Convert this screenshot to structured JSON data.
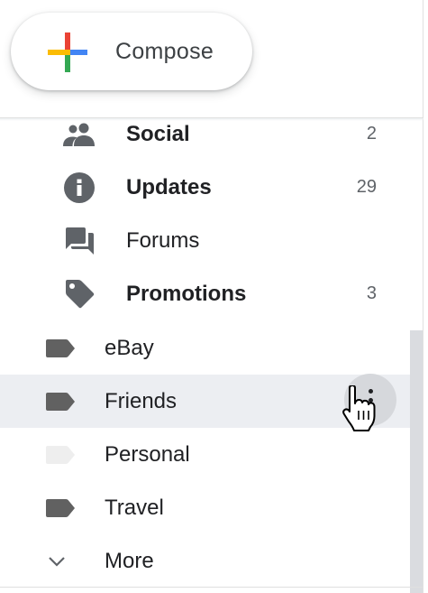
{
  "compose": {
    "label": "Compose"
  },
  "categories": [
    {
      "name": "Social",
      "count": "2",
      "icon": "people-icon",
      "bold": true
    },
    {
      "name": "Updates",
      "count": "29",
      "icon": "info-icon",
      "bold": true
    },
    {
      "name": "Forums",
      "count": "",
      "icon": "forum-icon",
      "bold": false
    },
    {
      "name": "Promotions",
      "count": "3",
      "icon": "tag-icon",
      "bold": true
    }
  ],
  "labels": [
    {
      "name": "eBay",
      "icon": "label-icon",
      "color": "#616161"
    },
    {
      "name": "Friends",
      "icon": "label-icon",
      "color": "#616161",
      "hovered": true
    },
    {
      "name": "Personal",
      "icon": "label-icon",
      "color": "#eeeeee"
    },
    {
      "name": "Travel",
      "icon": "label-icon",
      "color": "#616161"
    }
  ],
  "more": {
    "label": "More",
    "icon": "chevron-down-icon"
  },
  "colors": {
    "icon_gray": "#5f6368",
    "hover_bg": "#eceef2",
    "label_dark": "#616161",
    "label_light": "#eeeeee"
  }
}
